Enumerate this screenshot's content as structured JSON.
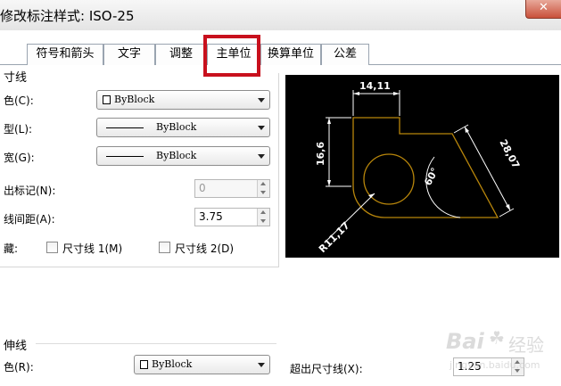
{
  "window": {
    "title": "修改标注样式: ISO-25"
  },
  "tabs": [
    {
      "label": "符号和箭头",
      "active": false
    },
    {
      "label": "文字",
      "active": false
    },
    {
      "label": "调整",
      "active": false
    },
    {
      "label": "主单位",
      "active": true
    },
    {
      "label": "换算单位",
      "active": false
    },
    {
      "label": "公差",
      "active": false
    }
  ],
  "dim_lines": {
    "section_title": "寸线",
    "color_label": "色(C):",
    "color_value": "ByBlock",
    "linetype_label": "型(L):",
    "linetype_value": "ByBlock",
    "lineweight_label": "宽(G):",
    "lineweight_value": "ByBlock",
    "extend_label": "出标记(N):",
    "extend_value": "0",
    "baseline_label": "线间距(A):",
    "baseline_value": "3.75",
    "suppress_label": "藏:",
    "suppress_1": "尺寸线 1(M)",
    "suppress_2": "尺寸线 2(D)"
  },
  "ext_lines": {
    "section_title": "伸线",
    "color_label": "色(R):",
    "color_value": "ByBlock",
    "extend_label": "超出尺寸线(X):",
    "extend_value": "1.25"
  },
  "preview": {
    "dim_top": "14,11",
    "dim_left": "16,6",
    "dim_right": "28,07",
    "dim_angle": "60°",
    "dim_radius": "R11,17"
  },
  "watermark": {
    "brand": "Bai",
    "brand_suffix": "经验",
    "url": "jingyan.baidu.com"
  },
  "colors": {
    "preview_bg": "#000000",
    "geometry": "#b8860b",
    "dimension": "#ffffff",
    "highlight": "#c8101d"
  }
}
